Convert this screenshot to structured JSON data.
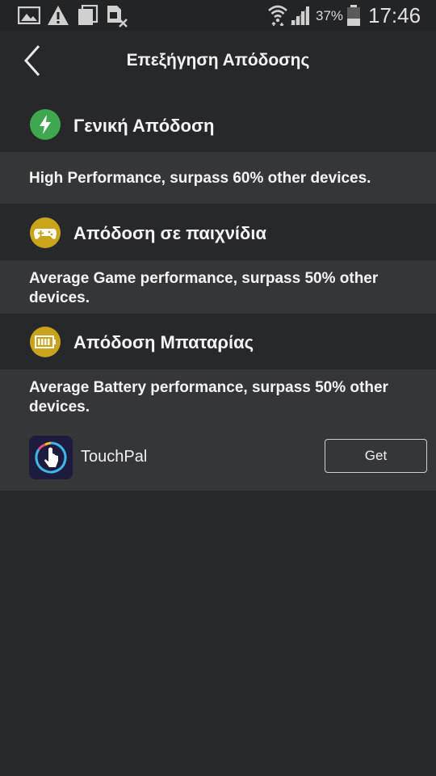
{
  "status_bar": {
    "battery_percent": "37%",
    "time": "17:46",
    "icons": [
      "image-icon",
      "warning-icon",
      "copy-icon",
      "sim-off-icon",
      "wifi-icon",
      "signal-icon",
      "battery-icon"
    ]
  },
  "app_bar": {
    "title": "Επεξήγηση Απόδοσης"
  },
  "sections": [
    {
      "title": "Γενική Απόδοση",
      "text": "High Performance, surpass 60% other devices.",
      "icon": "lightning-icon",
      "icon_color": "#3ea74f"
    },
    {
      "title": "Απόδοση σε παιχνίδια",
      "text": "Average Game performance, surpass 50% other devices.",
      "icon": "gamepad-icon",
      "icon_color": "#c9a41b"
    },
    {
      "title": "Απόδοση Μπαταρίας",
      "text": "Average Battery performance, surpass 50% other devices.",
      "icon": "battery-icon",
      "icon_color": "#c9a41b"
    }
  ],
  "ad": {
    "app_name": "TouchPal",
    "button_label": "Get",
    "icon": "touchpal-app-icon"
  },
  "colors": {
    "background": "#27282a",
    "panel": "#353638",
    "green": "#3ea74f",
    "gold": "#c9a41b"
  }
}
